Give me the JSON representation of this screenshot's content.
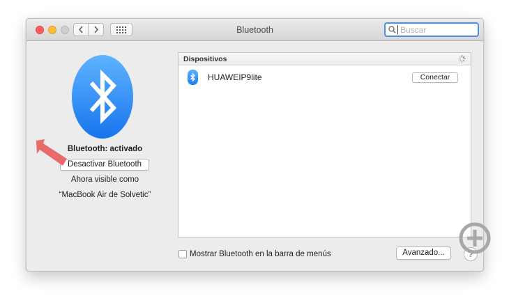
{
  "window": {
    "title": "Bluetooth"
  },
  "toolbar": {
    "back_icon": "chevron-left-icon",
    "forward_icon": "chevron-right-icon",
    "show_all_icon": "grid-icon"
  },
  "search": {
    "placeholder": "Buscar"
  },
  "sidebar": {
    "status_label": "Bluetooth: activado",
    "toggle_button_label": "Desactivar Bluetooth",
    "visible_label": "Ahora visible como",
    "device_name": "“MacBook Air de Solvetic”"
  },
  "devices": {
    "header": "Dispositivos",
    "items": [
      {
        "name": "HUAWEIP9lite",
        "action_label": "Conectar"
      }
    ]
  },
  "footer": {
    "show_in_menu_label": "Mostrar Bluetooth en la barra de menús",
    "show_in_menu_checked": false,
    "advanced_button_label": "Avanzado...",
    "help_label": "?"
  },
  "colors": {
    "accent": "#1f7ef1",
    "annotation_arrow": "#e86a6a",
    "close": "#fc605b",
    "minimize": "#fdbc40"
  }
}
